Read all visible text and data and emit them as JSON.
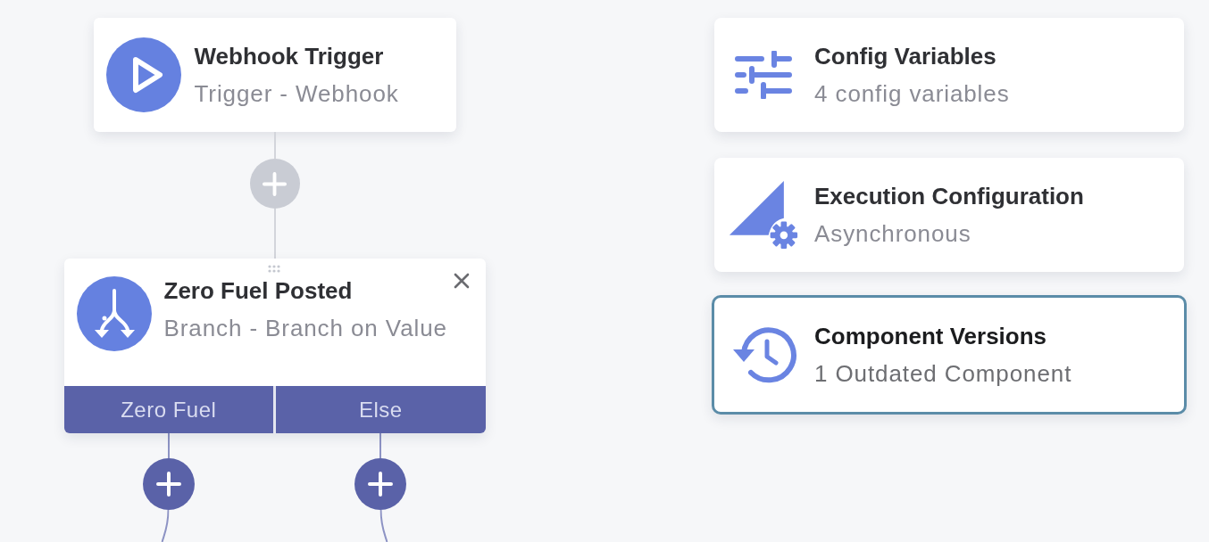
{
  "flow": {
    "nodes": [
      {
        "kind": "trigger",
        "title": "Webhook Trigger",
        "subtitle": "Trigger - Webhook"
      },
      {
        "kind": "branch",
        "title": "Zero Fuel Posted",
        "subtitle": "Branch - Branch on Value",
        "branches": [
          "Zero Fuel",
          "Else"
        ]
      }
    ]
  },
  "config_cards": [
    {
      "kind": "variables",
      "title": "Config Variables",
      "subtitle": "4 config variables",
      "highlighted": false
    },
    {
      "kind": "execution",
      "title": "Execution Configuration",
      "subtitle": "Asynchronous",
      "highlighted": false
    },
    {
      "kind": "versions",
      "title": "Component Versions",
      "subtitle": "1 Outdated Component",
      "highlighted": true
    }
  ]
}
